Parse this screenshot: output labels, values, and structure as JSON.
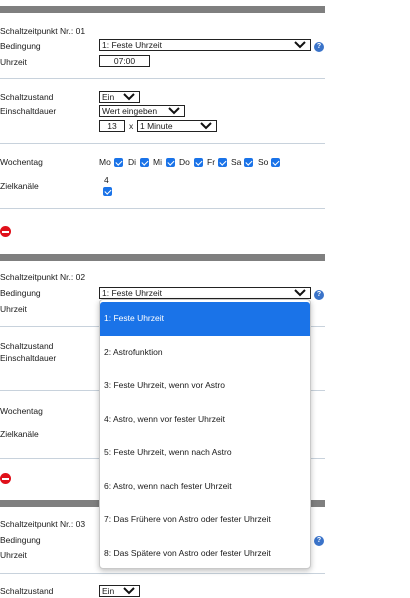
{
  "blocks": [
    {
      "heading": "Schaltzeitpunkt Nr.: 01",
      "condition_label": "Bedingung",
      "condition_value": "1: Feste Uhrzeit",
      "time_label": "Uhrzeit",
      "time_value": "07:00",
      "state_label": "Schaltzustand",
      "state_value": "Ein",
      "duration_label": "Einschaltdauer",
      "duration_mode": "Wert eingeben",
      "duration_value": "13",
      "duration_times": "x",
      "duration_unit": "1 Minute",
      "weekday_label": "Wochentag",
      "days": [
        "Mo",
        "Di",
        "Mi",
        "Do",
        "Fr",
        "Sa",
        "So"
      ],
      "channels_label": "Zielkanäle",
      "channel_number": "4"
    },
    {
      "heading": "Schaltzeitpunkt Nr.: 02",
      "condition_label": "Bedingung",
      "condition_value": "1: Feste Uhrzeit",
      "time_label": "Uhrzeit",
      "state_label": "Schaltzustand",
      "duration_label": "Einschaltdauer",
      "weekday_label": "Wochentag",
      "channels_label": "Zielkanäle"
    },
    {
      "heading": "Schaltzeitpunkt Nr.: 03",
      "condition_label": "Bedingung",
      "time_label": "Uhrzeit",
      "state_label": "Schaltzustand",
      "state_value": "Ein"
    }
  ],
  "dropdown_options": [
    "1: Feste Uhrzeit",
    "2: Astrofunktion",
    "3: Feste Uhrzeit, wenn vor Astro",
    "4: Astro, wenn vor fester Uhrzeit",
    "5: Feste Uhrzeit, wenn nach Astro",
    "6: Astro, wenn nach fester Uhrzeit",
    "7: Das Frühere von Astro oder fester Uhrzeit",
    "8: Das Spätere von Astro oder fester Uhrzeit"
  ],
  "help_glyph": "?",
  "colors": {
    "accent": "#1a73e8",
    "delete": "#e0101a",
    "separator": "#7f7f7f",
    "help": "#3a73c9"
  }
}
